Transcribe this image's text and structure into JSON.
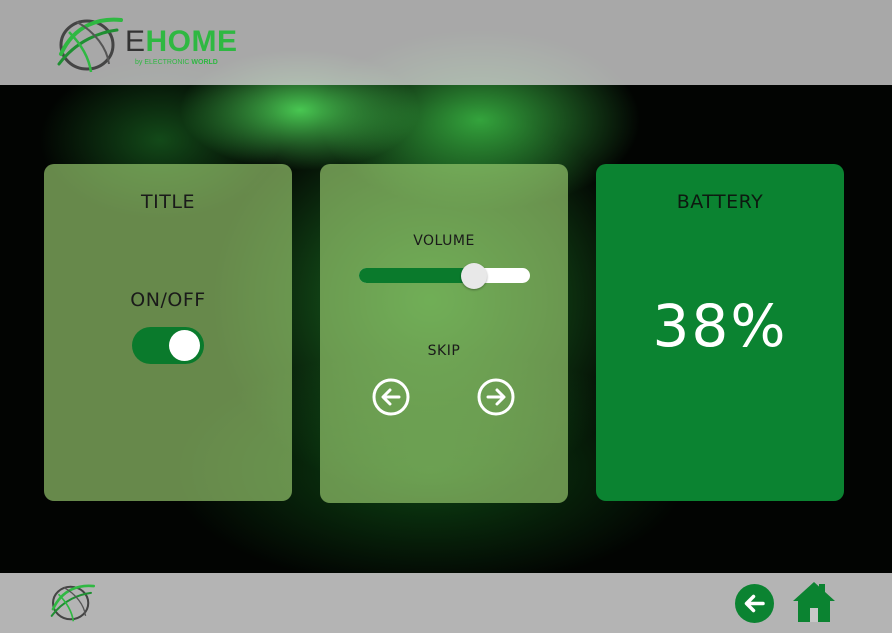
{
  "header": {
    "logo_letter": "E",
    "logo_rest": "HOME",
    "logo_sub_prefix": "by ELECTRONIC ",
    "logo_sub_bold": "WORLD",
    "logo_icon": "globe-swoosh-icon"
  },
  "cards": {
    "title": {
      "heading": "TITLE",
      "toggle_label": "ON/OFF",
      "toggle_on": true
    },
    "media": {
      "volume_label": "VOLUME",
      "volume_level": 0.67,
      "skip_label": "SKIP",
      "prev_icon": "arrow-left-circle-icon",
      "next_icon": "arrow-right-circle-icon"
    },
    "battery": {
      "heading": "BATTERY",
      "value": "38%"
    }
  },
  "footer": {
    "logo_icon": "globe-swoosh-icon",
    "back_icon": "back-arrow-icon",
    "home_icon": "home-icon"
  },
  "colors": {
    "accent": "#0b8331",
    "toggle_track": "#0a7a2c",
    "logo_green": "#2fb842",
    "card_bg": "#98c86e"
  }
}
